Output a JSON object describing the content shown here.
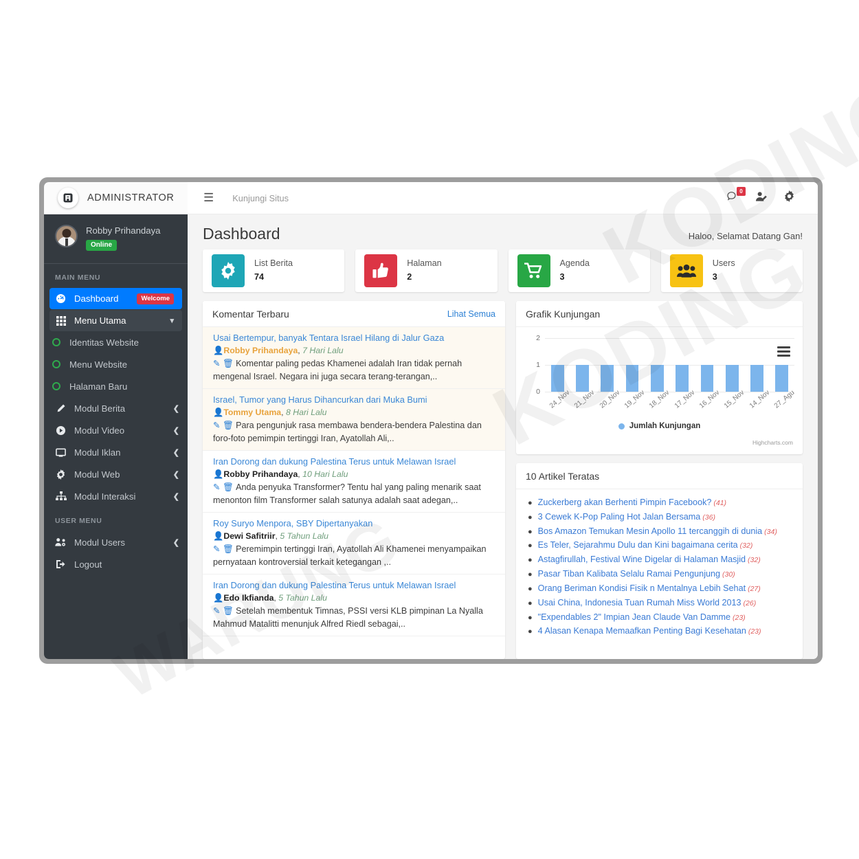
{
  "brand": {
    "title": "ADMINISTRATOR",
    "logo_icon": "app-logo-icon"
  },
  "sidebar": {
    "user": {
      "name": "Robby Prihandaya",
      "status": "Online"
    },
    "sections": [
      {
        "header": "MAIN MENU",
        "items": [
          {
            "label": "Dashboard",
            "icon": "speedometer-icon",
            "state": "active",
            "badge": "Welcome"
          },
          {
            "label": "Menu Utama",
            "icon": "grid-icon",
            "state": "open",
            "arrow": "chevron-down"
          },
          {
            "label": "Identitas Website",
            "icon": "circle-ring-icon",
            "state": "sub"
          },
          {
            "label": "Menu Website",
            "icon": "circle-ring-icon",
            "state": "sub"
          },
          {
            "label": "Halaman Baru",
            "icon": "circle-ring-icon",
            "state": "sub"
          },
          {
            "label": "Modul Berita",
            "icon": "pencil-icon",
            "arrow": "chevron-left"
          },
          {
            "label": "Modul Video",
            "icon": "play-circle-icon",
            "arrow": "chevron-left"
          },
          {
            "label": "Modul Iklan",
            "icon": "display-icon",
            "arrow": "chevron-left"
          },
          {
            "label": "Modul Web",
            "icon": "gear-icon",
            "arrow": "chevron-left"
          },
          {
            "label": "Modul Interaksi",
            "icon": "sitemap-icon",
            "arrow": "chevron-left"
          }
        ]
      },
      {
        "header": "USER MENU",
        "items": [
          {
            "label": "Modul Users",
            "icon": "users-cog-icon",
            "arrow": "chevron-left"
          },
          {
            "label": "Logout",
            "icon": "logout-icon"
          }
        ]
      }
    ]
  },
  "topbar": {
    "menu_icon": "hamburger-icon",
    "visit_link": "Kunjungi Situs",
    "icons": [
      {
        "name": "comments-icon",
        "badge": "0"
      },
      {
        "name": "user-edit-icon"
      },
      {
        "name": "gear-icon"
      }
    ]
  },
  "page": {
    "title": "Dashboard",
    "welcome": "Haloo, Selamat Datang Gan!"
  },
  "stats": [
    {
      "label": "List Berita",
      "value": "74",
      "color": "#1ea6b6",
      "icon": "gear-icon"
    },
    {
      "label": "Halaman",
      "value": "2",
      "color": "#dc3545",
      "icon": "thumbs-up-icon"
    },
    {
      "label": "Agenda",
      "value": "3",
      "color": "#28a745",
      "icon": "cart-icon"
    },
    {
      "label": "Users",
      "value": "3",
      "color": "#f7c213",
      "icon": "users-icon"
    }
  ],
  "comments_panel": {
    "title": "Komentar Terbaru",
    "link": "Lihat Semua",
    "items": [
      {
        "title": "Usai Bertempur, banyak Tentara Israel Hilang di Jalur Gaza",
        "author": "Robby Prihandaya",
        "author_color": "orange",
        "time": "7 Hari Lalu",
        "body": "Komentar paling pedas Khamenei adalah Iran tidak pernah mengenal Israel. Negara ini juga secara terang-terangan,..",
        "highlight": true
      },
      {
        "title": "Israel, Tumor yang Harus Dihancurkan dari Muka Bumi",
        "author": "Tommy Utama",
        "author_color": "orange",
        "time": "8 Hari Lalu",
        "body": "Para pengunjuk rasa membawa bendera-bendera Palestina dan foro-foto pemimpin tertinggi Iran, Ayatollah Ali,..",
        "highlight": true
      },
      {
        "title": "Iran Dorong dan dukung Palestina Terus untuk Melawan Israel",
        "author": "Robby Prihandaya",
        "author_color": "dark",
        "time": "10 Hari Lalu",
        "body": "Anda penyuka Transformer? Tentu hal yang paling menarik saat menonton film Transformer salah satunya adalah saat adegan,..",
        "highlight": false
      },
      {
        "title": "Roy Suryo Menpora, SBY Dipertanyakan",
        "author": "Dewi Safitriir",
        "author_color": "dark",
        "time": "5 Tahun Lalu",
        "body": "Peremimpin tertinggi Iran, Ayatollah Ali Khamenei menyampaikan pernyataan kontroversial terkait ketegangan ,..",
        "highlight": false
      },
      {
        "title": "Iran Dorong dan dukung Palestina Terus untuk Melawan Israel",
        "author": "Edo Ikfianda",
        "author_color": "dark",
        "time": "5 Tahun Lalu",
        "body": "Setelah membentuk Timnas, PSSI versi KLB pimpinan La Nyalla Mahmud Matalitti menunjuk Alfred Riedl sebagai,..",
        "highlight": false
      }
    ],
    "action_icons": [
      "edit-icon",
      "trash-icon"
    ],
    "author_icon": "user-icon"
  },
  "chart_panel": {
    "title": "Grafik Kunjungan",
    "menu_icon": "chart-context-menu-icon"
  },
  "chart_data": {
    "type": "bar",
    "title": "Grafik Kunjungan",
    "categories": [
      "24_Nov",
      "21_Nov",
      "20_Nov",
      "19_Nov",
      "18_Nov",
      "17_Nov",
      "16_Nov",
      "15_Nov",
      "14_Nov",
      "27_Agu"
    ],
    "values": [
      1,
      1,
      1,
      1,
      1,
      1,
      1,
      1,
      1,
      1
    ],
    "series": [
      {
        "name": "Jumlah Kunjungan",
        "values": [
          1,
          1,
          1,
          1,
          1,
          1,
          1,
          1,
          1,
          1
        ]
      }
    ],
    "yticks": [
      0,
      1,
      2
    ],
    "ylim": [
      0,
      2
    ],
    "xlabel": "",
    "ylabel": "",
    "legend": [
      "Jumlah Kunjungan"
    ],
    "legend_position": "bottom",
    "grid": true,
    "bar_color": "#7cb5ec",
    "credit": "Highcharts.com"
  },
  "articles_panel": {
    "title": "10 Artikel Teratas",
    "items": [
      {
        "title": "Zuckerberg akan Berhenti Pimpin Facebook?",
        "count": "(41)"
      },
      {
        "title": "3 Cewek K-Pop Paling Hot Jalan Bersama",
        "count": "(36)"
      },
      {
        "title": "Bos Amazon Temukan Mesin Apollo 11 tercanggih di dunia",
        "count": "(34)"
      },
      {
        "title": "Es Teler, Sejarahmu Dulu dan Kini bagaimana cerita",
        "count": "(32)"
      },
      {
        "title": "Astagfirullah, Festival Wine Digelar di Halaman Masjid",
        "count": "(32)"
      },
      {
        "title": "Pasar Tiban Kalibata Selalu Ramai Pengunjung",
        "count": "(30)"
      },
      {
        "title": "Orang Beriman Kondisi Fisik n Mentalnya Lebih Sehat",
        "count": "(27)"
      },
      {
        "title": "Usai China, Indonesia Tuan Rumah Miss World 2013",
        "count": "(26)"
      },
      {
        "title": "\"Expendables 2\" Impian Jean Claude Van Damme",
        "count": "(23)"
      },
      {
        "title": "4 Alasan Kenapa Memaafkan Penting Bagi Kesehatan",
        "count": "(23)"
      }
    ]
  },
  "watermark": {
    "line1": "KODING",
    "line2": "KODING",
    "line3": "WARUNG"
  }
}
